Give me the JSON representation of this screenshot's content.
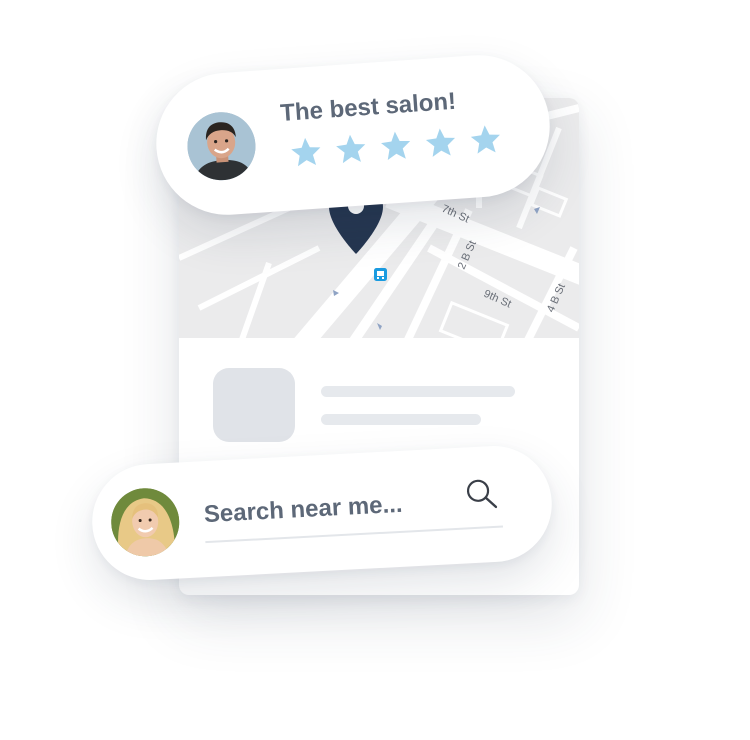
{
  "review": {
    "text": "The best salon!",
    "rating": 5,
    "rating_max": 5,
    "star_color": "#a4d4ee",
    "avatar_icon": "user-avatar-male"
  },
  "search": {
    "placeholder": "Search near me...",
    "icon": "search-icon",
    "avatar_icon": "user-avatar-female"
  },
  "map": {
    "streets": [
      "7th St",
      "2 B St",
      "9th St",
      "4 B St"
    ],
    "pin_icon": "location-pin-icon",
    "pin_color": "#253650",
    "transit_icon": "bus-stop-icon",
    "transit_color": "#1a9be0"
  },
  "listing": {
    "placeholder_color": "#e0e3e8"
  }
}
